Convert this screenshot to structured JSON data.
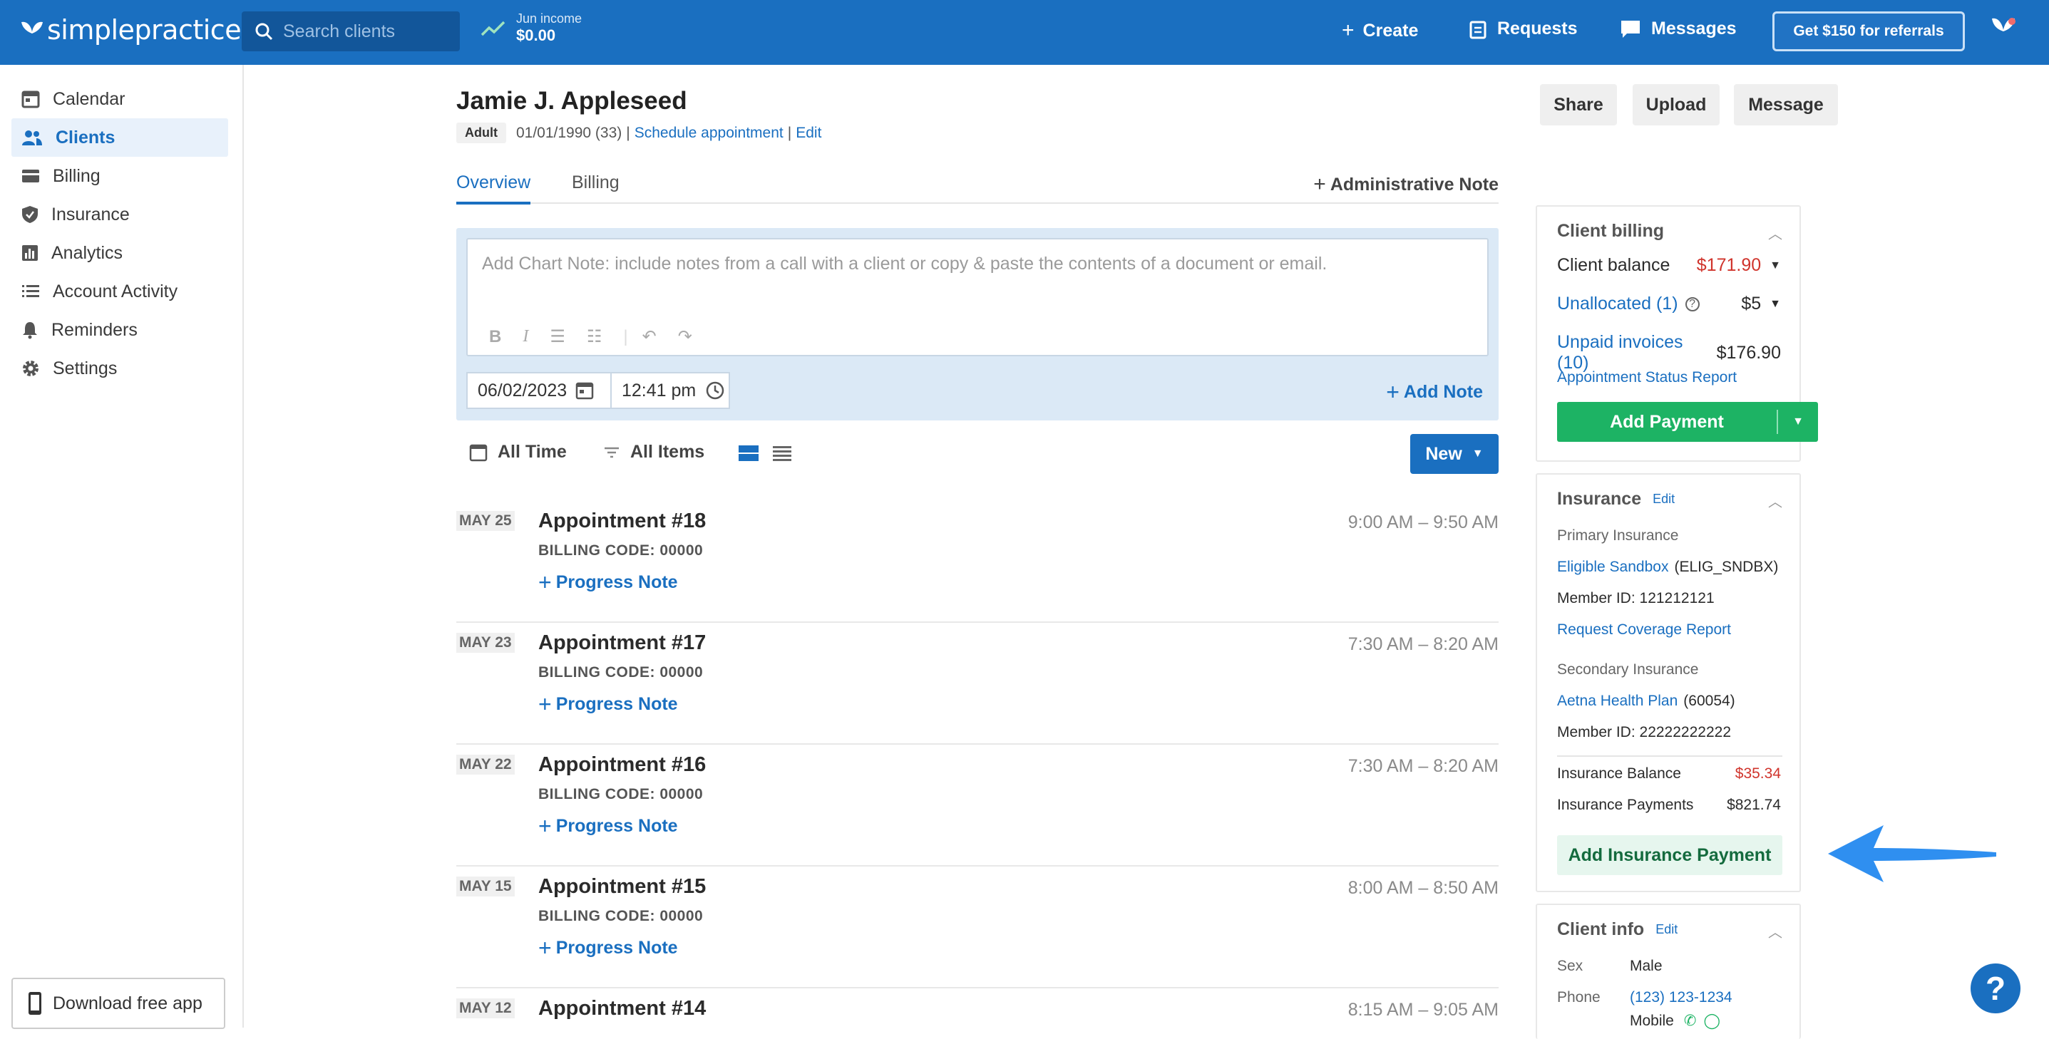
{
  "brand": {
    "name": "simplepractice",
    "accent": "#1a6fc0",
    "success": "#1db364",
    "danger": "#d0342c"
  },
  "topnav": {
    "search_placeholder": "Search clients",
    "income_label": "Jun income",
    "income_value": "$0.00",
    "create": "Create",
    "requests": "Requests",
    "messages": "Messages",
    "referral": "Get $150 for referrals"
  },
  "sidebar": {
    "items": [
      {
        "label": "Calendar",
        "icon": "calendar-icon"
      },
      {
        "label": "Clients",
        "icon": "clients-icon"
      },
      {
        "label": "Billing",
        "icon": "card-icon"
      },
      {
        "label": "Insurance",
        "icon": "shield-icon"
      },
      {
        "label": "Analytics",
        "icon": "bar-chart-icon"
      },
      {
        "label": "Account Activity",
        "icon": "list-icon"
      },
      {
        "label": "Reminders",
        "icon": "bell-icon"
      },
      {
        "label": "Settings",
        "icon": "gear-icon"
      }
    ],
    "download_app": "Download free app"
  },
  "client": {
    "name": "Jamie J. Appleseed",
    "type": "Adult",
    "dob": "01/01/1990 (33)",
    "sep": "|",
    "schedule": "Schedule appointment",
    "edit": "Edit"
  },
  "actions": {
    "share": "Share",
    "upload": "Upload",
    "message": "Message"
  },
  "tabs": {
    "overview": "Overview",
    "billing": "Billing",
    "admin_note": "Administrative Note"
  },
  "chart_note": {
    "placeholder": "Add Chart Note: include notes from a call with a client or copy & paste the contents of a document or email.",
    "date": "06/02/2023",
    "time": "12:41 pm",
    "add_note": "Add Note"
  },
  "filters": {
    "time": "All Time",
    "items": "All Items",
    "new": "New"
  },
  "appointments": [
    {
      "date": "MAY 25",
      "title": "Appointment #18",
      "code": "BILLING CODE: 00000",
      "time": "9:00 AM – 9:50 AM",
      "note": "Progress Note"
    },
    {
      "date": "MAY 23",
      "title": "Appointment #17",
      "code": "BILLING CODE: 00000",
      "time": "7:30 AM – 8:20 AM",
      "note": "Progress Note"
    },
    {
      "date": "MAY 22",
      "title": "Appointment #16",
      "code": "BILLING CODE: 00000",
      "time": "7:30 AM – 8:20 AM",
      "note": "Progress Note"
    },
    {
      "date": "MAY 15",
      "title": "Appointment #15",
      "code": "BILLING CODE: 00000",
      "time": "8:00 AM – 8:50 AM",
      "note": "Progress Note"
    },
    {
      "date": "MAY 12",
      "title": "Appointment #14",
      "code": "",
      "time": "8:15 AM – 9:05 AM",
      "note": ""
    }
  ],
  "billing_panel": {
    "title": "Client billing",
    "balance_label": "Client balance",
    "balance_value": "$171.90",
    "unallocated_label": "Unallocated (1)",
    "unallocated_value": "$5",
    "unpaid_label": "Unpaid invoices (10)",
    "unpaid_value": "$176.90",
    "status_report": "Appointment Status Report",
    "add_payment": "Add Payment"
  },
  "insurance_panel": {
    "title": "Insurance",
    "edit": "Edit",
    "primary_label": "Primary Insurance",
    "primary_name": "Eligible Sandbox",
    "primary_code": "(ELIG_SNDBX)",
    "primary_member": "Member ID: 121212121",
    "coverage_report": "Request Coverage Report",
    "secondary_label": "Secondary Insurance",
    "secondary_name": "Aetna Health Plan",
    "secondary_code": "(60054)",
    "secondary_member": "Member ID: 22222222222",
    "balance_label": "Insurance Balance",
    "balance_value": "$35.34",
    "payments_label": "Insurance Payments",
    "payments_value": "$821.74",
    "add_payment": "Add Insurance Payment"
  },
  "client_info": {
    "title": "Client info",
    "edit": "Edit",
    "sex_label": "Sex",
    "sex_value": "Male",
    "phone_label": "Phone",
    "phone_value": "(123) 123-1234",
    "phone_type": "Mobile"
  },
  "help": "?"
}
